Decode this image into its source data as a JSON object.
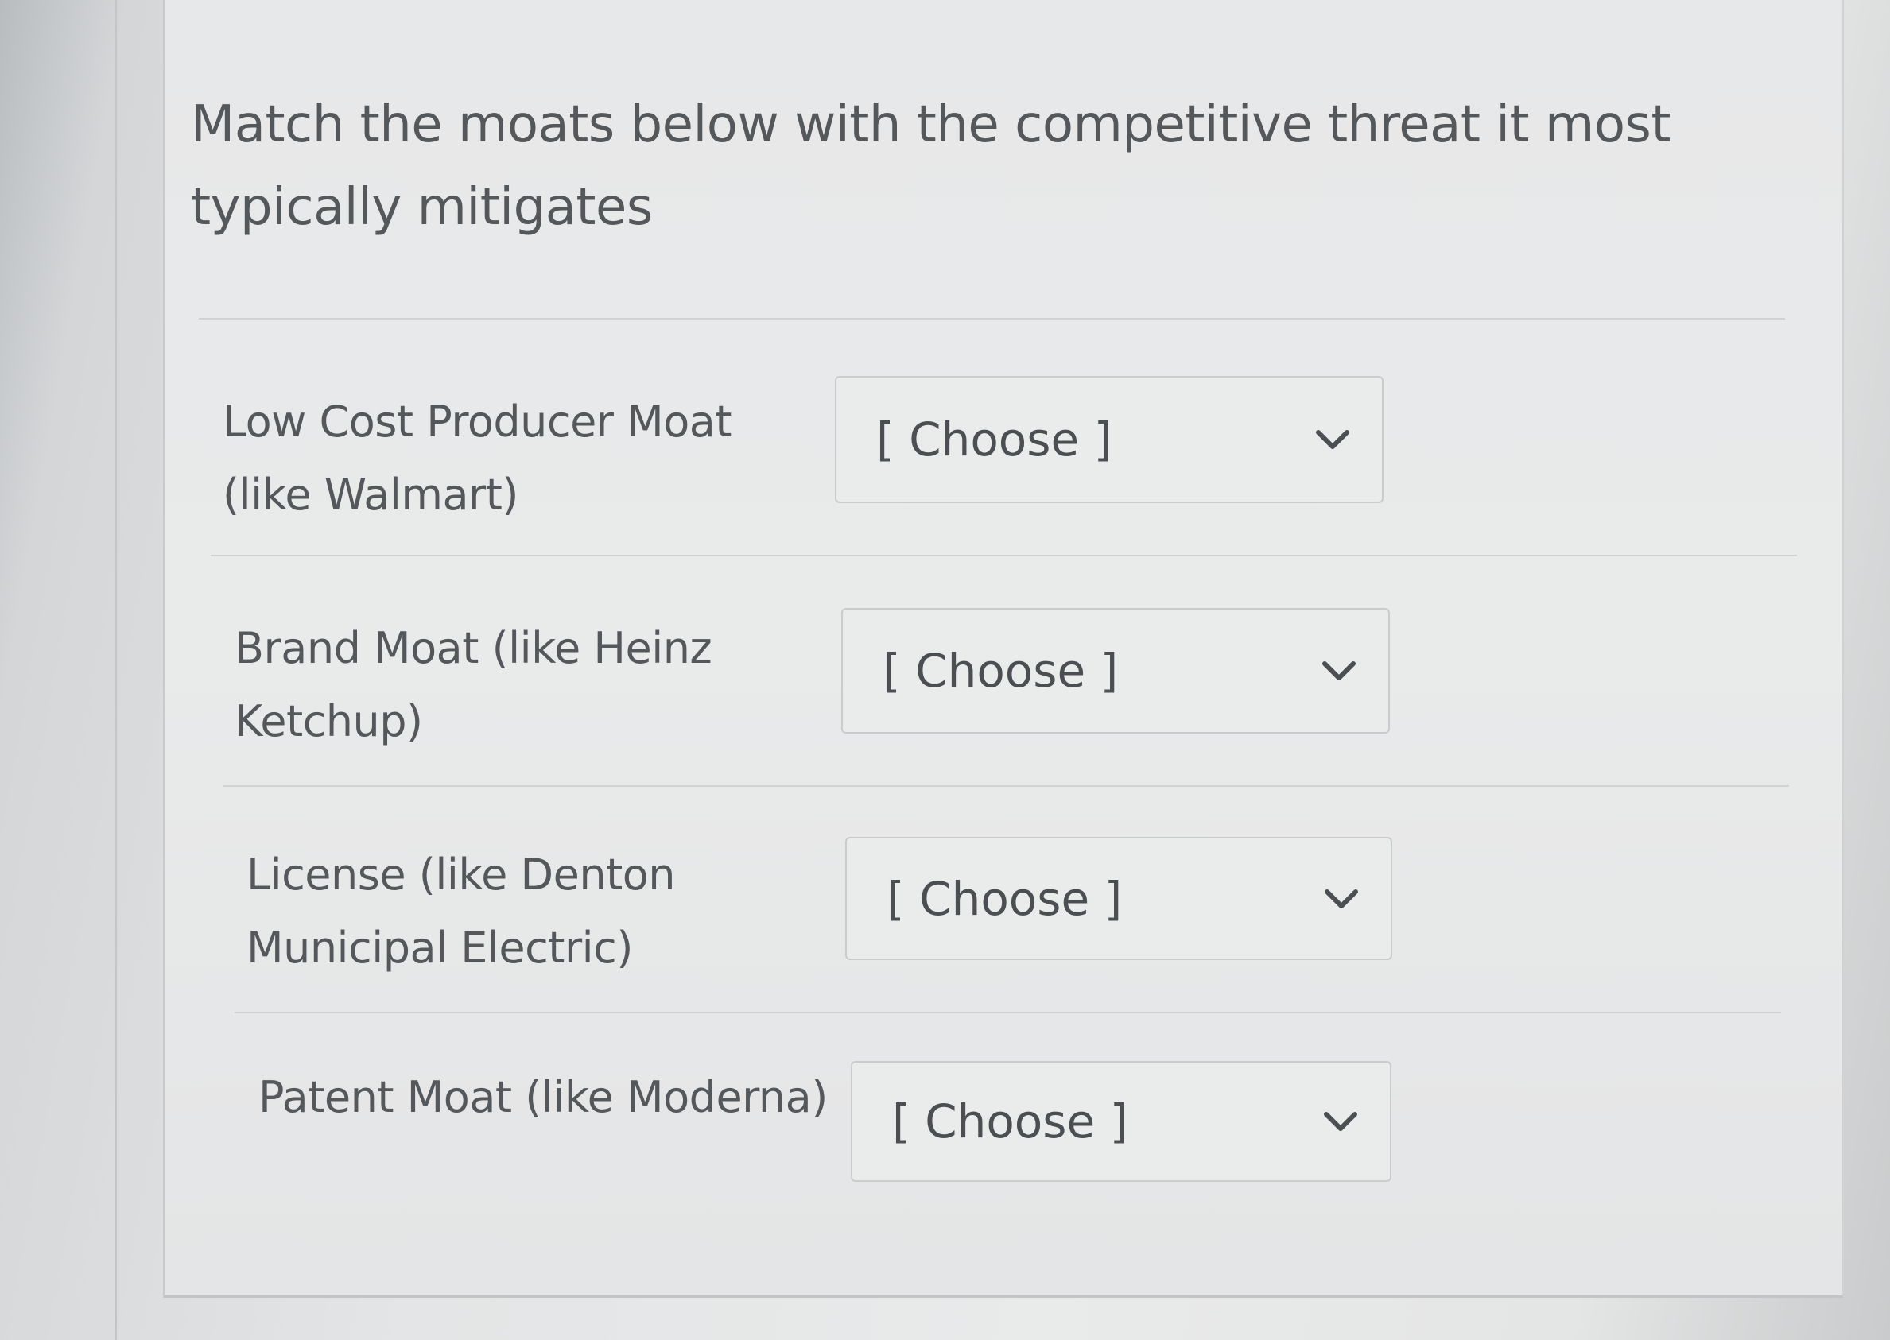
{
  "question": {
    "text": "Match the moats below with the competitive threat it most typically mitigates"
  },
  "rows": [
    {
      "label": "Low Cost Producer Moat (like Walmart)",
      "select": {
        "value": "[ Choose ]",
        "icon": "chevron-down-icon"
      }
    },
    {
      "label": "Brand Moat (like Heinz Ketchup)",
      "select": {
        "value": "[ Choose ]",
        "icon": "chevron-down-icon"
      }
    },
    {
      "label": "License (like Denton Municipal Electric)",
      "select": {
        "value": "[ Choose ]",
        "icon": "chevron-down-icon"
      }
    },
    {
      "label": "Patent Moat (like Moderna)",
      "select": {
        "value": "[ Choose ]",
        "icon": "chevron-down-icon"
      }
    }
  ]
}
